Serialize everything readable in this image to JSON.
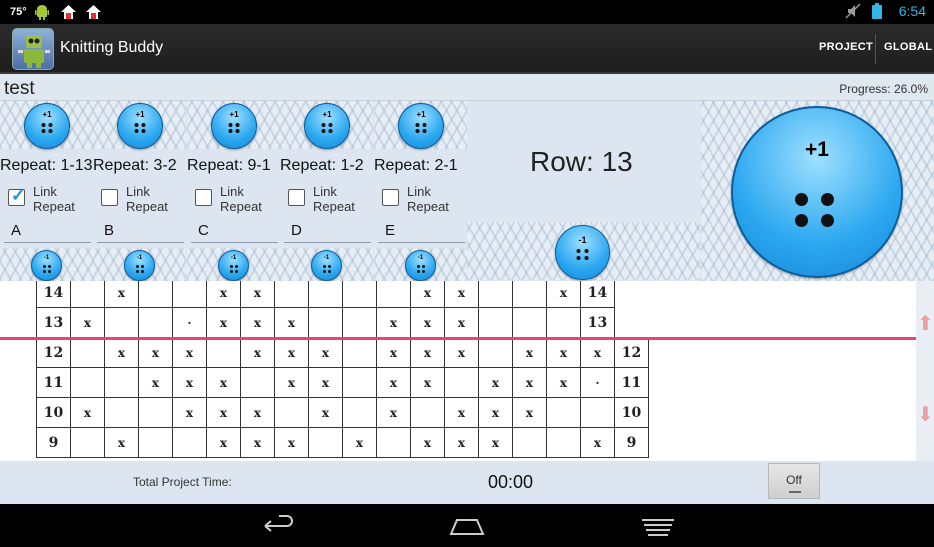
{
  "status_bar": {
    "temperature": "75°",
    "clock": "6:54",
    "icons": [
      "android-icon",
      "home-icon",
      "home-icon",
      "mute-icon",
      "battery-icon"
    ]
  },
  "action_bar": {
    "title": "Knitting Buddy",
    "project_label": "PROJECT",
    "global_label": "GLOBAL"
  },
  "project": {
    "name": "test",
    "progress": "Progress: 26.0%"
  },
  "counters": [
    {
      "plus_label": "+1",
      "repeat": "Repeat: 1-13",
      "link_label": [
        "Link",
        "Repeat"
      ],
      "linked": true,
      "letter": "A",
      "minus_label": "-1"
    },
    {
      "plus_label": "+1",
      "repeat": "Repeat: 3-2",
      "link_label": [
        "Link",
        "Repeat"
      ],
      "linked": false,
      "letter": "B",
      "minus_label": "-1"
    },
    {
      "plus_label": "+1",
      "repeat": "Repeat: 9-1",
      "link_label": [
        "Link",
        "Repeat"
      ],
      "linked": false,
      "letter": "C",
      "minus_label": "-1"
    },
    {
      "plus_label": "+1",
      "repeat": "Repeat: 1-2",
      "link_label": [
        "Link",
        "Repeat"
      ],
      "linked": false,
      "letter": "D",
      "minus_label": "-1"
    },
    {
      "plus_label": "+1",
      "repeat": "Repeat: 2-1",
      "link_label": [
        "Link",
        "Repeat"
      ],
      "linked": false,
      "letter": "E",
      "minus_label": "-1"
    }
  ],
  "row_counter": {
    "label": "Row: 13",
    "minus_label": "-1",
    "big_plus_label": "+1"
  },
  "pattern_chart": {
    "rows": [
      [
        "14",
        "",
        "x",
        "",
        "",
        "x",
        "x",
        "",
        "",
        "",
        "",
        "x",
        "x",
        "",
        "",
        "x",
        "14"
      ],
      [
        "13",
        "x",
        "",
        "",
        "·",
        "x",
        "x",
        "x",
        "",
        "",
        "x",
        "x",
        "x",
        "",
        "",
        "",
        "13"
      ],
      [
        "12",
        "",
        "x",
        "x",
        "x",
        "",
        "x",
        "x",
        "x",
        "",
        "x",
        "x",
        "x",
        "",
        "x",
        "x",
        "x",
        "12"
      ],
      [
        "11",
        "",
        "",
        "x",
        "x",
        "x",
        "",
        "x",
        "x",
        "",
        "x",
        "x",
        "",
        "x",
        "x",
        "x",
        "·",
        "11"
      ],
      [
        "10",
        "x",
        "",
        "",
        "x",
        "x",
        "x",
        "",
        "x",
        "",
        "x",
        "",
        "x",
        "x",
        "x",
        "",
        "",
        "10"
      ],
      [
        "9",
        "",
        "x",
        "",
        "",
        "x",
        "x",
        "x",
        "",
        "x",
        "",
        "x",
        "x",
        "x",
        "",
        "",
        "x",
        "9"
      ]
    ]
  },
  "footer": {
    "total_label": "Total Project Time:",
    "timer": "00:00",
    "toggle_label": "Off"
  }
}
